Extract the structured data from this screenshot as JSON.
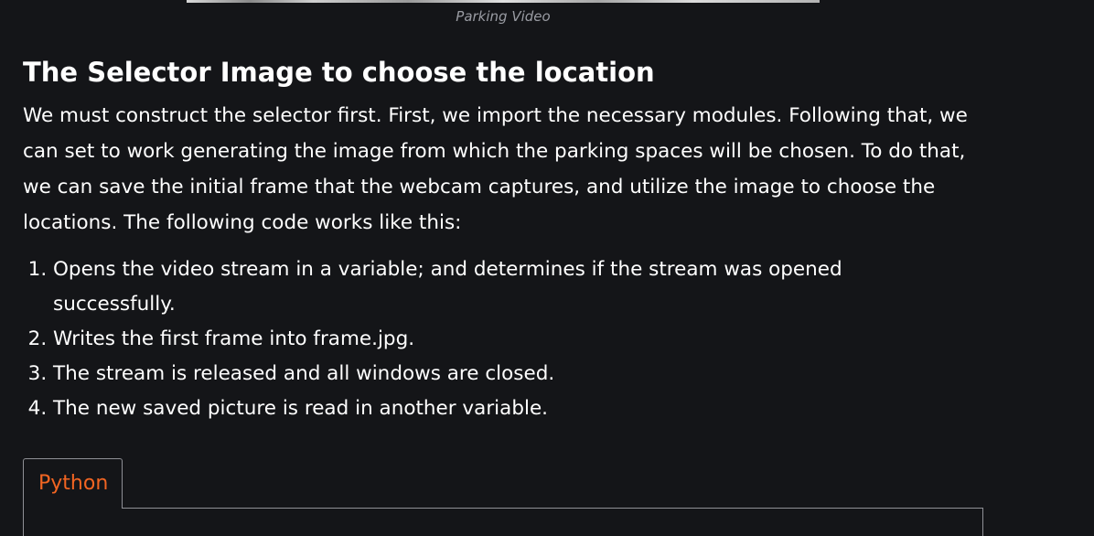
{
  "video": {
    "caption": "Parking Video"
  },
  "article": {
    "heading": "The Selector Image to choose the location",
    "paragraph": "We must construct the selector first. First, we import the necessary modules. Following that, we can set to work generating the image from which the parking spaces will be chosen. To do that, we can save the initial frame that the webcam captures, and utilize the image to choose the locations. The following code works like this:",
    "steps": [
      "Opens the video stream in a variable; and determines if the stream was opened successfully.",
      "Writes the first frame into frame.jpg.",
      "The stream is released and all windows are closed.",
      "The new saved picture is read in another variable."
    ]
  },
  "code_tabs": {
    "active_tab": "Python"
  },
  "colors": {
    "background": "#141518",
    "text": "#ffffff",
    "caption": "#9a9ca3",
    "tab_accent": "#f26522",
    "border": "#8f9096"
  }
}
